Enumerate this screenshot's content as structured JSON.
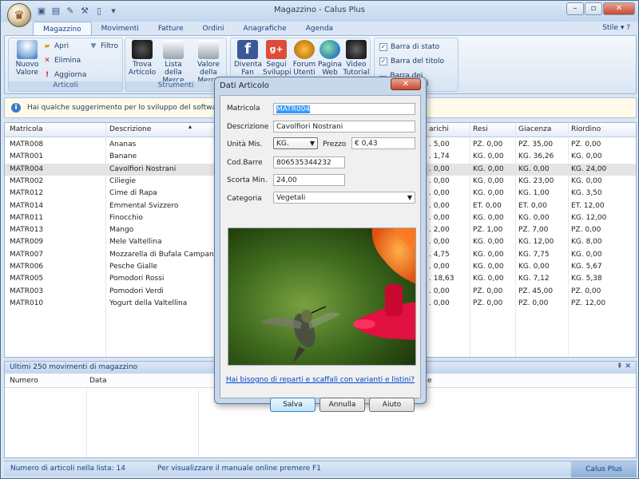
{
  "window": {
    "title": "Magazzino - Calus Plus"
  },
  "tabs": [
    {
      "label": "Magazzino"
    },
    {
      "label": "Movimenti"
    },
    {
      "label": "Fatture"
    },
    {
      "label": "Ordini"
    },
    {
      "label": "Anagrafiche"
    },
    {
      "label": "Agenda"
    }
  ],
  "stile": "Stile",
  "ribbon": {
    "articoli": {
      "label": "Articoli",
      "nuovo": "Nuovo Valore",
      "apri": "Apri",
      "elimina": "Elimina",
      "aggiorna": "Aggiorna",
      "filtro": "Filtro"
    },
    "strumenti": {
      "label": "Strumenti",
      "trova": "Trova Articolo",
      "lista": "Lista della Merce",
      "valore": "Valore della Merce"
    },
    "social": {
      "diventa": "Diventa Fan",
      "segui": "Segui Sviluppi",
      "forum": "Forum Utenti",
      "pagina": "Pagina Web",
      "video": "Video Tutorial"
    },
    "options": {
      "barra_stato": "Barra di stato",
      "barra_titolo": "Barra del titolo",
      "barra_movimenti": "Barra dei movimenti"
    }
  },
  "infobar": {
    "text": "Hai qualche suggerimento per lo sviluppo del software? Al"
  },
  "grid": {
    "headers": {
      "matricola": "Matricola",
      "descrizione": "Descrizione",
      "carichi": "arichi",
      "resi": "Resi",
      "giacenza": "Giacenza",
      "riordino": "Riordino"
    },
    "rows": [
      {
        "matricola": "MATR008",
        "descrizione": "Ananas",
        "carichi": ". 5,00",
        "resi": "PZ. 0,00",
        "giacenza": "PZ. 35,00",
        "riordino": "PZ. 0,00"
      },
      {
        "matricola": "MATR001",
        "descrizione": "Banane",
        "carichi": ". 1,74",
        "resi": "KG. 0,00",
        "giacenza": "KG. 36,26",
        "riordino": "KG. 0,00"
      },
      {
        "matricola": "MATR004",
        "descrizione": "Cavolfiori Nostrani",
        "carichi": ". 0,00",
        "resi": "KG. 0,00",
        "giacenza": "KG. 0,00",
        "riordino": "KG. 24,00"
      },
      {
        "matricola": "MATR002",
        "descrizione": "Ciliegie",
        "carichi": ". 0,00",
        "resi": "KG. 0,00",
        "giacenza": "KG. 23,00",
        "riordino": "KG. 0,00"
      },
      {
        "matricola": "MATR012",
        "descrizione": "Cime di Rapa",
        "carichi": ". 0,00",
        "resi": "KG. 0,00",
        "giacenza": "KG. 1,00",
        "riordino": "KG. 3,50"
      },
      {
        "matricola": "MATR014",
        "descrizione": "Emmental Svizzero",
        "carichi": ". 0,00",
        "resi": "ET. 0,00",
        "giacenza": "ET. 0,00",
        "riordino": "ET. 12,00"
      },
      {
        "matricola": "MATR011",
        "descrizione": "Finocchio",
        "carichi": ". 0,00",
        "resi": "KG. 0,00",
        "giacenza": "KG. 0,00",
        "riordino": "KG. 12,00"
      },
      {
        "matricola": "MATR013",
        "descrizione": "Mango",
        "carichi": ". 2,00",
        "resi": "PZ. 1,00",
        "giacenza": "PZ. 7,00",
        "riordino": "PZ. 0,00"
      },
      {
        "matricola": "MATR009",
        "descrizione": "Mele Valtellina",
        "carichi": ". 0,00",
        "resi": "KG. 0,00",
        "giacenza": "KG. 12,00",
        "riordino": "KG. 8,00"
      },
      {
        "matricola": "MATR007",
        "descrizione": "Mozzarella di Bufala Campana",
        "carichi": ". 4,75",
        "resi": "KG. 0,00",
        "giacenza": "KG. 7,75",
        "riordino": "KG. 0,00"
      },
      {
        "matricola": "MATR006",
        "descrizione": "Pesche Gialle",
        "carichi": ". 0,00",
        "resi": "KG. 0,00",
        "giacenza": "KG. 0,00",
        "riordino": "KG. 5,67"
      },
      {
        "matricola": "MATR005",
        "descrizione": "Pomodori Rossi",
        "carichi": ". 18,63",
        "resi": "KG. 0,00",
        "giacenza": "KG. 7,12",
        "riordino": "KG. 5,38"
      },
      {
        "matricola": "MATR003",
        "descrizione": "Pomodori Verdi",
        "carichi": ". 0,00",
        "resi": "PZ. 0,00",
        "giacenza": "PZ. 45,00",
        "riordino": "PZ. 0,00"
      },
      {
        "matricola": "MATR010",
        "descrizione": "Yogurt della Valtellina",
        "carichi": ". 0,00",
        "resi": "PZ. 0,00",
        "giacenza": "PZ. 0,00",
        "riordino": "PZ. 12,00"
      }
    ]
  },
  "lower": {
    "title": "Ultimi 250 movimenti di magazzino",
    "col_numero": "Numero",
    "col_data": "Data",
    "col_e": "e"
  },
  "status": {
    "count": "Numero di articoli nella lista: 14",
    "manual": "Per visualizzare il manuale online premere F1",
    "brand": "Calus Plus"
  },
  "dialog": {
    "title": "Dati Articolo",
    "matricola_label": "Matricola",
    "matricola": "MATR004",
    "descrizione_label": "Descrizione",
    "descrizione": "Cavolfiori Nostrani",
    "unita_label": "Unità Mis.",
    "unita": "KG.",
    "prezzo_label": "Prezzo",
    "prezzo": "€ 0,43",
    "codbarre_label": "Cod.Barre",
    "codbarre": "806535344232",
    "scorta_label": "Scorta Min.",
    "scorta": "24,00",
    "categoria_label": "Categoria",
    "categoria": "Vegetali",
    "link": "Hai bisogno di reparti e scaffali con varianti e listini?",
    "salva": "Salva",
    "annulla": "Annulla",
    "aiuto": "Aiuto"
  }
}
